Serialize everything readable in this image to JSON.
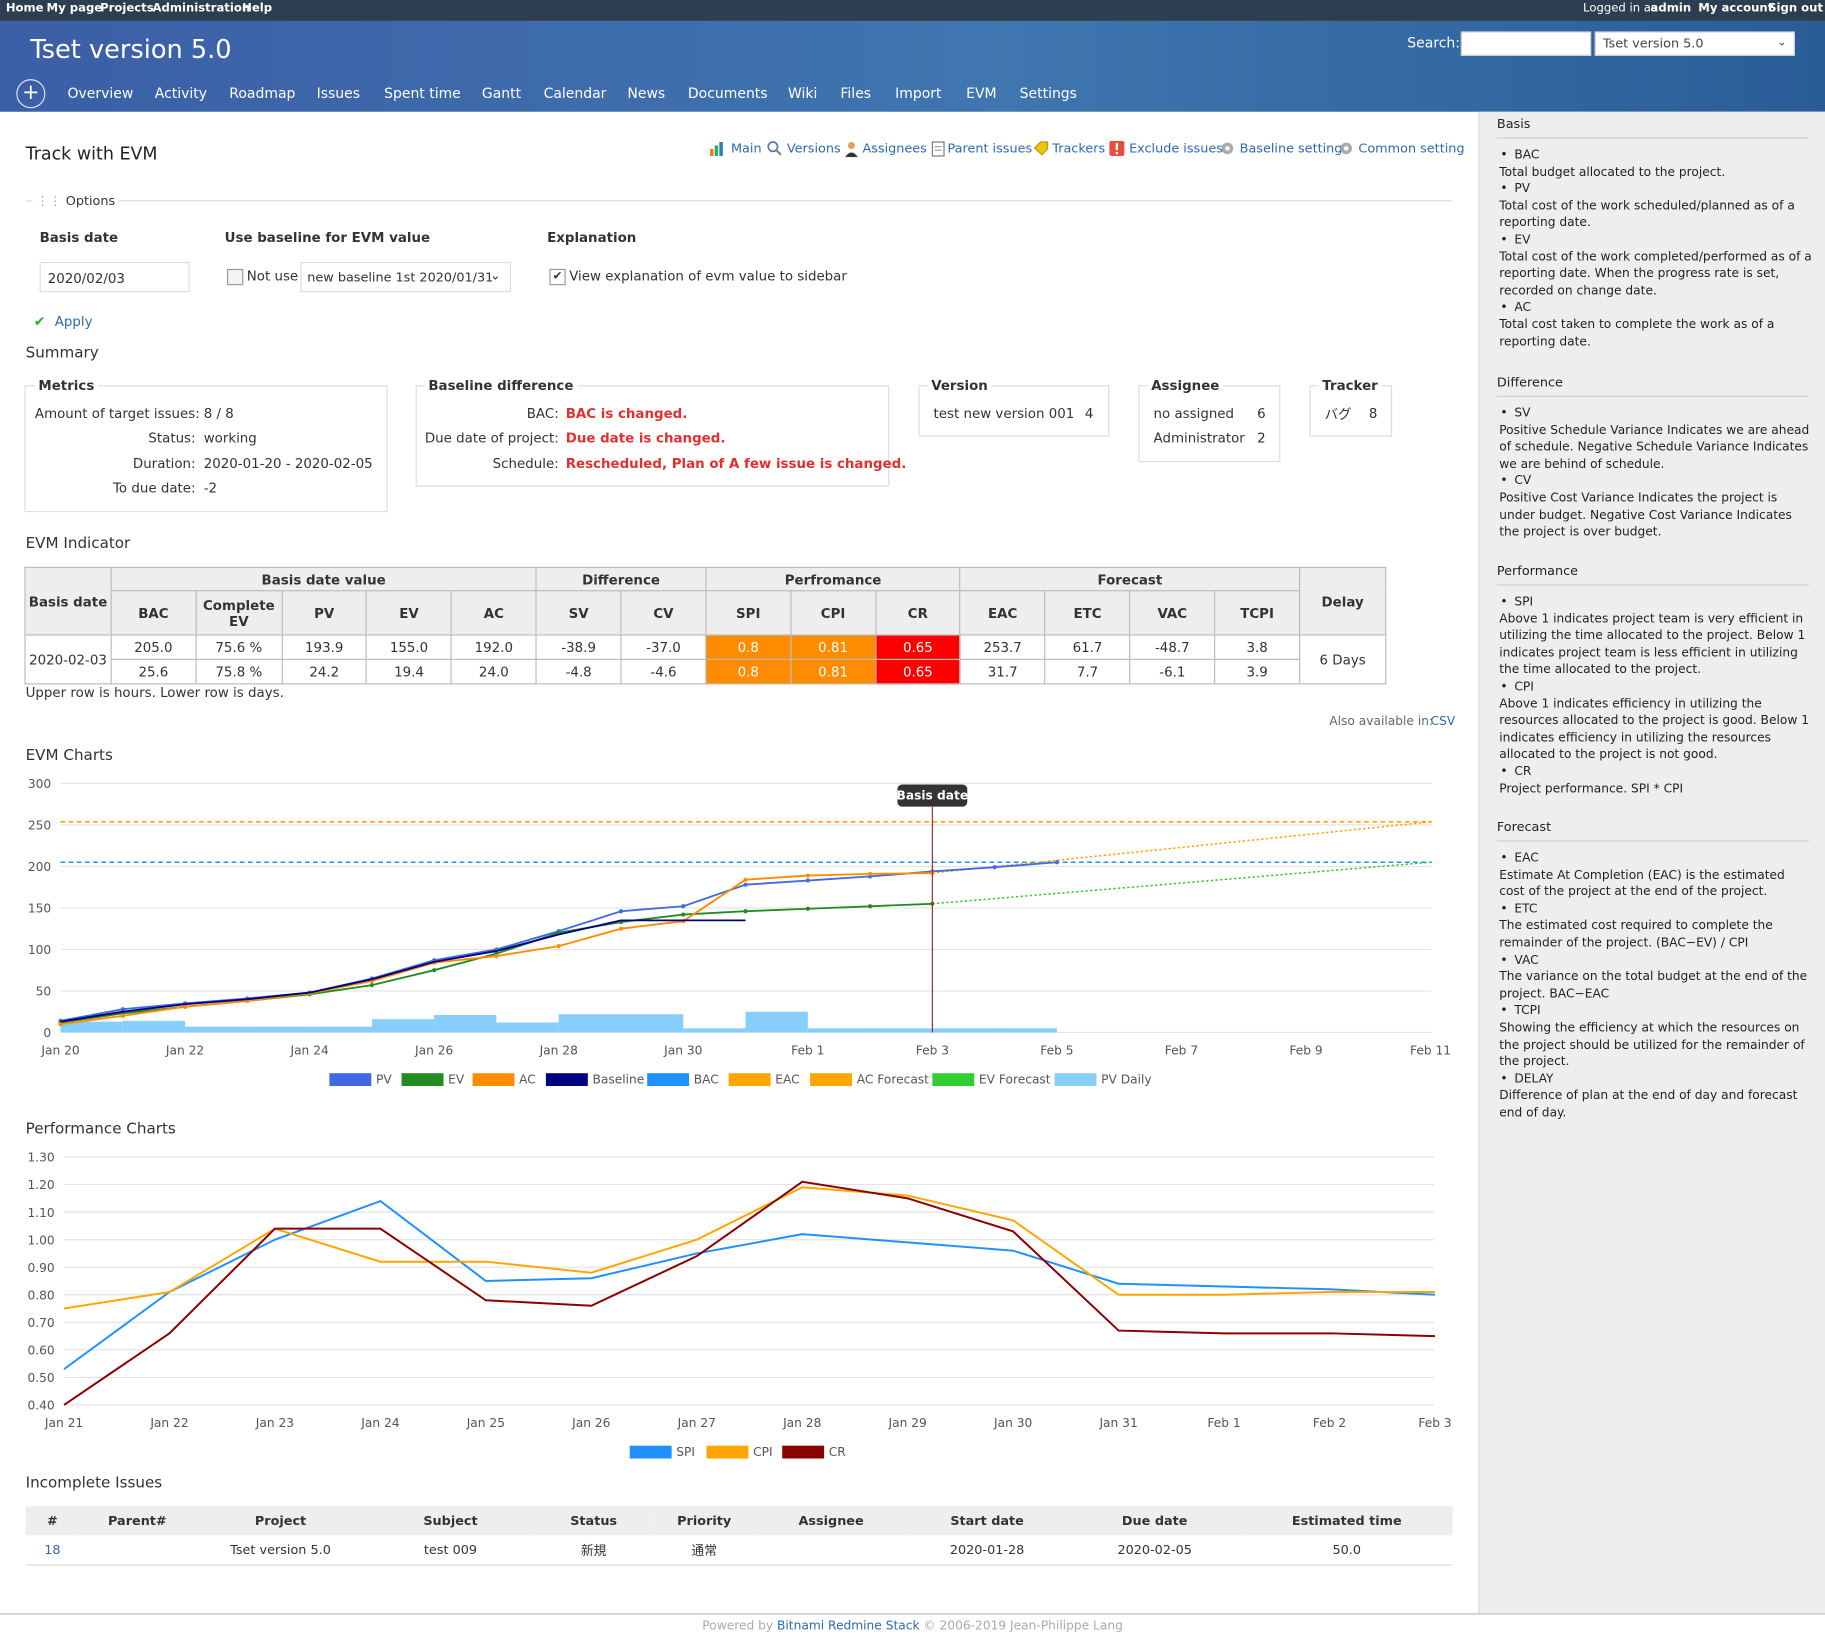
{
  "topbar": {
    "home": "Home",
    "mypage": "My page",
    "projects": "Projects",
    "admin": "Administration",
    "help": "Help",
    "logged_prefix": "Logged in as",
    "logged_user": "admin",
    "account": "My account",
    "signout": "Sign out"
  },
  "header": {
    "title": "Tset version 5.0",
    "search_label": "Search:",
    "project_select": "Tset version 5.0",
    "plus": "+",
    "menu": [
      "Overview",
      "Activity",
      "Roadmap",
      "Issues",
      "Spent time",
      "Gantt",
      "Calendar",
      "News",
      "Documents",
      "Wiki",
      "Files",
      "Import",
      "EVM",
      "Settings"
    ]
  },
  "page": {
    "title": "Track with EVM",
    "contextual": [
      "Main",
      "Versions",
      "Assignees",
      "Parent issues",
      "Trackers",
      "Exclude issues",
      "Baseline setting",
      "Common setting"
    ],
    "options_legend": "Options",
    "basis_date_label": "Basis date",
    "basis_date_value": "2020/02/03",
    "baseline_label": "Use baseline for EVM value",
    "not_use_label": "Not use",
    "baseline_value": "new baseline 1st 2020/01/31",
    "explanation_label": "Explanation",
    "explanation_check": "View explanation of evm value to sidebar",
    "apply": "Apply"
  },
  "summary": {
    "title": "Summary",
    "metrics": {
      "legend": "Metrics",
      "rows": [
        {
          "k": "Amount of target issues:",
          "v": "8 / 8"
        },
        {
          "k": "Status:",
          "v": "working"
        },
        {
          "k": "Duration:",
          "v": "2020-01-20 - 2020-02-05"
        },
        {
          "k": "To due date:",
          "v": "-2"
        }
      ]
    },
    "baseline": {
      "legend": "Baseline difference",
      "rows": [
        {
          "k": "BAC:",
          "v": "BAC is changed."
        },
        {
          "k": "Due date of project:",
          "v": "Due date is changed."
        },
        {
          "k": "Schedule:",
          "v": "Rescheduled, Plan of A few issue is changed."
        }
      ]
    },
    "version": {
      "legend": "Version",
      "name": "test new version 001",
      "count": "4"
    },
    "assignee": {
      "legend": "Assignee",
      "rows": [
        {
          "k": "no assigned",
          "v": "6"
        },
        {
          "k": "Administrator",
          "v": "2"
        }
      ]
    },
    "tracker": {
      "legend": "Tracker",
      "name": "バグ",
      "count": "8"
    }
  },
  "evm": {
    "title": "EVM Indicator",
    "group_headers": [
      "Basis date value",
      "Difference",
      "Perfromance",
      "Forecast"
    ],
    "basis_date_header": "Basis date",
    "delay_header": "Delay",
    "col_headers": [
      "BAC",
      "Complete EV",
      "PV",
      "EV",
      "AC",
      "SV",
      "CV",
      "SPI",
      "CPI",
      "CR",
      "EAC",
      "ETC",
      "VAC",
      "TCPI"
    ],
    "basis_date": "2020-02-03",
    "delay": "6 Days",
    "rows": [
      [
        "205.0",
        "75.6 %",
        "193.9",
        "155.0",
        "192.0",
        "-38.9",
        "-37.0",
        "0.8",
        "0.81",
        "0.65",
        "253.7",
        "61.7",
        "-48.7",
        "3.8"
      ],
      [
        "25.6",
        "75.8 %",
        "24.2",
        "19.4",
        "24.0",
        "-4.8",
        "-4.6",
        "0.8",
        "0.81",
        "0.65",
        "31.7",
        "7.7",
        "-6.1",
        "3.9"
      ]
    ],
    "note": "Upper row is hours. Lower row is days.",
    "also_available": "Also available in:",
    "csv": "CSV",
    "colors": {
      "spi": "#ff8c00",
      "cpi": "#ff8c00",
      "cr": "#ff0000"
    }
  },
  "evm_chart_title": "EVM Charts",
  "perf_chart_title": "Performance Charts",
  "chart_data": [
    {
      "type": "line",
      "title": "",
      "x": [
        "Jan 20",
        "Jan 21",
        "Jan 22",
        "Jan 23",
        "Jan 24",
        "Jan 25",
        "Jan 26",
        "Jan 27",
        "Jan 28",
        "Jan 29",
        "Jan 30",
        "Jan 31",
        "Feb 1",
        "Feb 2",
        "Feb 3",
        "Feb 4",
        "Feb 5",
        "Feb 6",
        "Feb 7",
        "Feb 8",
        "Feb 9",
        "Feb 10",
        "Feb 11"
      ],
      "x_tick_labels": [
        "Jan 20",
        "Jan 22",
        "Jan 24",
        "Jan 26",
        "Jan 28",
        "Jan 30",
        "Feb 1",
        "Feb 3",
        "Feb 5",
        "Feb 7",
        "Feb 9",
        "Feb 11"
      ],
      "ylim": [
        0,
        300
      ],
      "y_ticks": [
        "0",
        "50",
        "100",
        "150",
        "200",
        "250",
        "300"
      ],
      "annotation": "Basis date",
      "basis_date_index": 14,
      "series": [
        {
          "name": "PV",
          "color": "#4169e1",
          "values": [
            14,
            28,
            35,
            41,
            48,
            65,
            87,
            100,
            122,
            146,
            152,
            178,
            183,
            188,
            193.9,
            199,
            205
          ]
        },
        {
          "name": "EV",
          "color": "#228b22",
          "values": [
            12,
            23,
            31,
            38,
            46,
            57,
            75,
            95,
            120,
            133,
            142,
            146,
            149,
            152,
            155
          ]
        },
        {
          "name": "AC",
          "color": "#ff8c00",
          "values": [
            10,
            20,
            31,
            38,
            47,
            62,
            84,
            92,
            104,
            125,
            134,
            184,
            189,
            191,
            192
          ]
        },
        {
          "name": "Baseline",
          "color": "#000080",
          "values": [
            13,
            25,
            34,
            40,
            48,
            64,
            85,
            98,
            118,
            135,
            135,
            135
          ]
        },
        {
          "name": "BAC",
          "color": "#1e90ff",
          "values": [
            205
          ]
        },
        {
          "name": "EAC",
          "color": "#ffa500",
          "values": [
            253.7
          ]
        },
        {
          "name": "AC Forecast",
          "color": "#ffa500",
          "values": [
            192,
            253.7
          ]
        },
        {
          "name": "EV Forecast",
          "color": "#32cd32",
          "values": [
            155,
            205
          ]
        },
        {
          "name": "PV Daily",
          "color": "#87cefa",
          "values": [
            13,
            14,
            7,
            7,
            7,
            16,
            21,
            12,
            22,
            22,
            5,
            25,
            5,
            5,
            5,
            5,
            0
          ]
        }
      ]
    },
    {
      "type": "line",
      "title": "",
      "x": [
        "Jan 21",
        "Jan 22",
        "Jan 23",
        "Jan 24",
        "Jan 25",
        "Jan 26",
        "Jan 27",
        "Jan 28",
        "Jan 29",
        "Jan 30",
        "Jan 31",
        "Feb 1",
        "Feb 2",
        "Feb 3"
      ],
      "ylim": [
        0.4,
        1.3
      ],
      "y_ticks": [
        "0.40",
        "0.50",
        "0.60",
        "0.70",
        "0.80",
        "0.90",
        "1.00",
        "1.10",
        "1.20",
        "1.30"
      ],
      "series": [
        {
          "name": "SPI",
          "color": "#1e90ff",
          "values": [
            0.53,
            0.81,
            1.0,
            1.14,
            0.85,
            0.86,
            0.95,
            1.02,
            0.99,
            0.96,
            0.84,
            0.83,
            0.82,
            0.8
          ]
        },
        {
          "name": "CPI",
          "color": "#ffa500",
          "values": [
            0.75,
            0.81,
            1.04,
            0.92,
            0.92,
            0.88,
            1.0,
            1.19,
            1.16,
            1.07,
            0.8,
            0.8,
            0.81,
            0.81
          ]
        },
        {
          "name": "CR",
          "color": "#8b0000",
          "values": [
            0.4,
            0.66,
            1.04,
            1.04,
            0.78,
            0.76,
            0.94,
            1.21,
            1.15,
            1.03,
            0.67,
            0.66,
            0.66,
            0.65
          ]
        }
      ]
    }
  ],
  "issues": {
    "title": "Incomplete Issues",
    "headers": [
      "#",
      "Parent#",
      "Project",
      "Subject",
      "Status",
      "Priority",
      "Assignee",
      "Start date",
      "Due date",
      "Estimated time"
    ],
    "rows": [
      [
        "18",
        "",
        "Tset version 5.0",
        "test 009",
        "新規",
        "通常",
        "",
        "2020-01-28",
        "2020-02-05",
        "50.0"
      ]
    ]
  },
  "sidebar": {
    "basis": {
      "title": "Basis",
      "items": [
        {
          "term": "BAC",
          "desc": "Total budget allocated to the project."
        },
        {
          "term": "PV",
          "desc": "Total cost of the work scheduled/planned as of a reporting date."
        },
        {
          "term": "EV",
          "desc": "Total cost of the work completed/performed as of a reporting date. When the progress rate is set, recorded on change date."
        },
        {
          "term": "AC",
          "desc": "Total cost taken to complete the work as of a reporting date."
        }
      ]
    },
    "difference": {
      "title": "Difference",
      "items": [
        {
          "term": "SV",
          "desc": "Positive Schedule Variance Indicates we are ahead of schedule. Negative Schedule Variance Indicates we are behind of schedule."
        },
        {
          "term": "CV",
          "desc": "Positive Cost Variance Indicates the project is under budget. Negative Cost Variance Indicates the project is over budget."
        }
      ]
    },
    "performance": {
      "title": "Performance",
      "items": [
        {
          "term": "SPI",
          "desc": "Above 1 indicates project team is very efficient in utilizing the time allocated to the project. Below 1 indicates project team is less efficient in utilizing the time allocated to the project."
        },
        {
          "term": "CPI",
          "desc": "Above 1 indicates efficiency in utilizing the resources allocated to the project is good. Below 1 indicates efficiency in utilizing the resources allocated to the project is not good."
        },
        {
          "term": "CR",
          "desc": "Project performance. SPI * CPI"
        }
      ]
    },
    "forecast": {
      "title": "Forecast",
      "items": [
        {
          "term": "EAC",
          "desc": "Estimate At Completion (EAC) is the estimated cost of the project at the end of the project."
        },
        {
          "term": "ETC",
          "desc": "The estimated cost required to complete the remainder of the project. (BAC−EV) / CPI"
        },
        {
          "term": "VAC",
          "desc": "The variance on the total budget at the end of the project. BAC−EAC"
        },
        {
          "term": "TCPI",
          "desc": "Showing the efficiency at which the resources on the project should be utilized for the remainder of the project."
        },
        {
          "term": "DELAY",
          "desc": "Difference of plan at the end of day and forecast end of day."
        }
      ]
    }
  },
  "footer": {
    "prefix": "Powered by",
    "link": "Bitnami Redmine Stack",
    "suffix": "© 2006-2019 Jean-Philippe Lang"
  }
}
